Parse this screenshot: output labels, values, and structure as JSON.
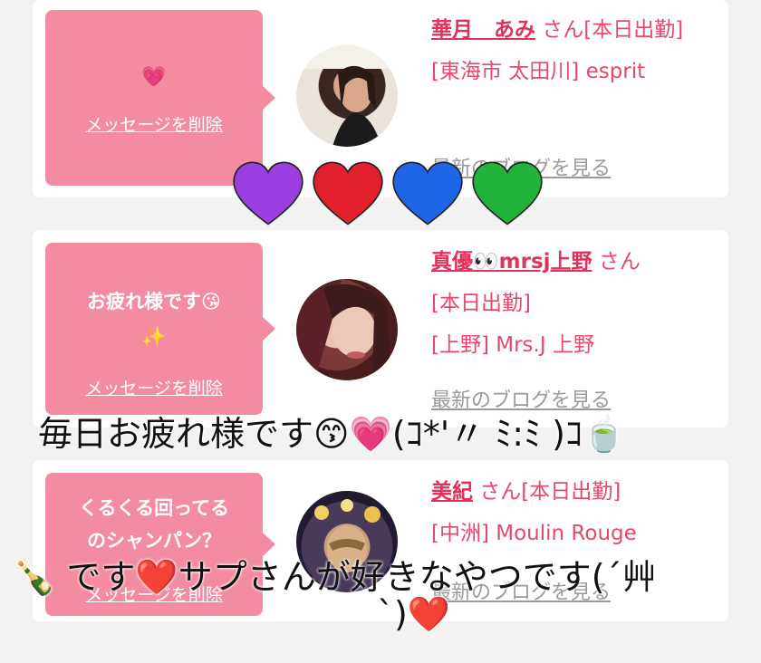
{
  "cards": [
    {
      "bubble_icon": "💗",
      "delete_label": "メッセージを削除",
      "name": "華月　あみ",
      "suffix": " さん[本日出勤]",
      "shop": "[東海市 太田川] esprit",
      "blog_label": "最新のブログを見る"
    },
    {
      "message": "お疲れ様です😘",
      "bubble_icon": "✨",
      "delete_label": "メッセージを削除",
      "name": "真優👀mrsj上野",
      "suffix": " さん",
      "status": "[本日出勤]",
      "shop": "[上野] Mrs.J 上野",
      "blog_label": "最新のブログを見る"
    },
    {
      "message_line1": "くるくる回ってる",
      "message_line2": "のシャンパン？",
      "delete_label": "メッセージを削除",
      "name": "美紀",
      "suffix": " さん[本日出勤]",
      "shop": "[中洲] Moulin Rouge",
      "blog_label": "最新のブログを見る"
    }
  ],
  "overlay": {
    "hearts": [
      "purple-heart",
      "red-heart",
      "blue-heart",
      "green-heart"
    ],
    "heart_colors": [
      "#9b3fe0",
      "#e3202e",
      "#1e66e8",
      "#22b33a"
    ],
    "line1": "毎日お疲れ様です😙💗(ｺ*'〃 ﾐ:ﾐ )ｺ🍵",
    "line2": "🍾 です❤️サプさんが好きなやつです(´艸",
    "line3": "`)❤️"
  }
}
